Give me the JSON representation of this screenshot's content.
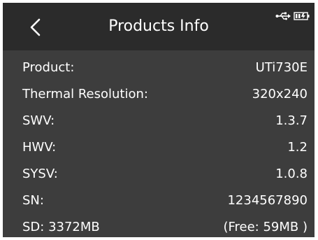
{
  "header": {
    "title": "Products Info",
    "back_icon": "chevron-left-icon",
    "status_icons": [
      "usb-icon",
      "battery-charging-icon"
    ]
  },
  "rows": [
    {
      "label": "Product:",
      "value": "UTi730E"
    },
    {
      "label": "Thermal Resolution:",
      "value": "320x240"
    },
    {
      "label": "SWV:",
      "value": "1.3.7"
    },
    {
      "label": "HWV:",
      "value": "1.2"
    },
    {
      "label": "SYSV:",
      "value": "1.0.8"
    },
    {
      "label": "SN:",
      "value": "1234567890"
    },
    {
      "label": "SD: 3372MB",
      "value": "(Free: 59MB )"
    }
  ],
  "colors": {
    "header_bg": "#2b2b2b",
    "body_bg": "#3d3d3d",
    "text": "#ffffff"
  }
}
